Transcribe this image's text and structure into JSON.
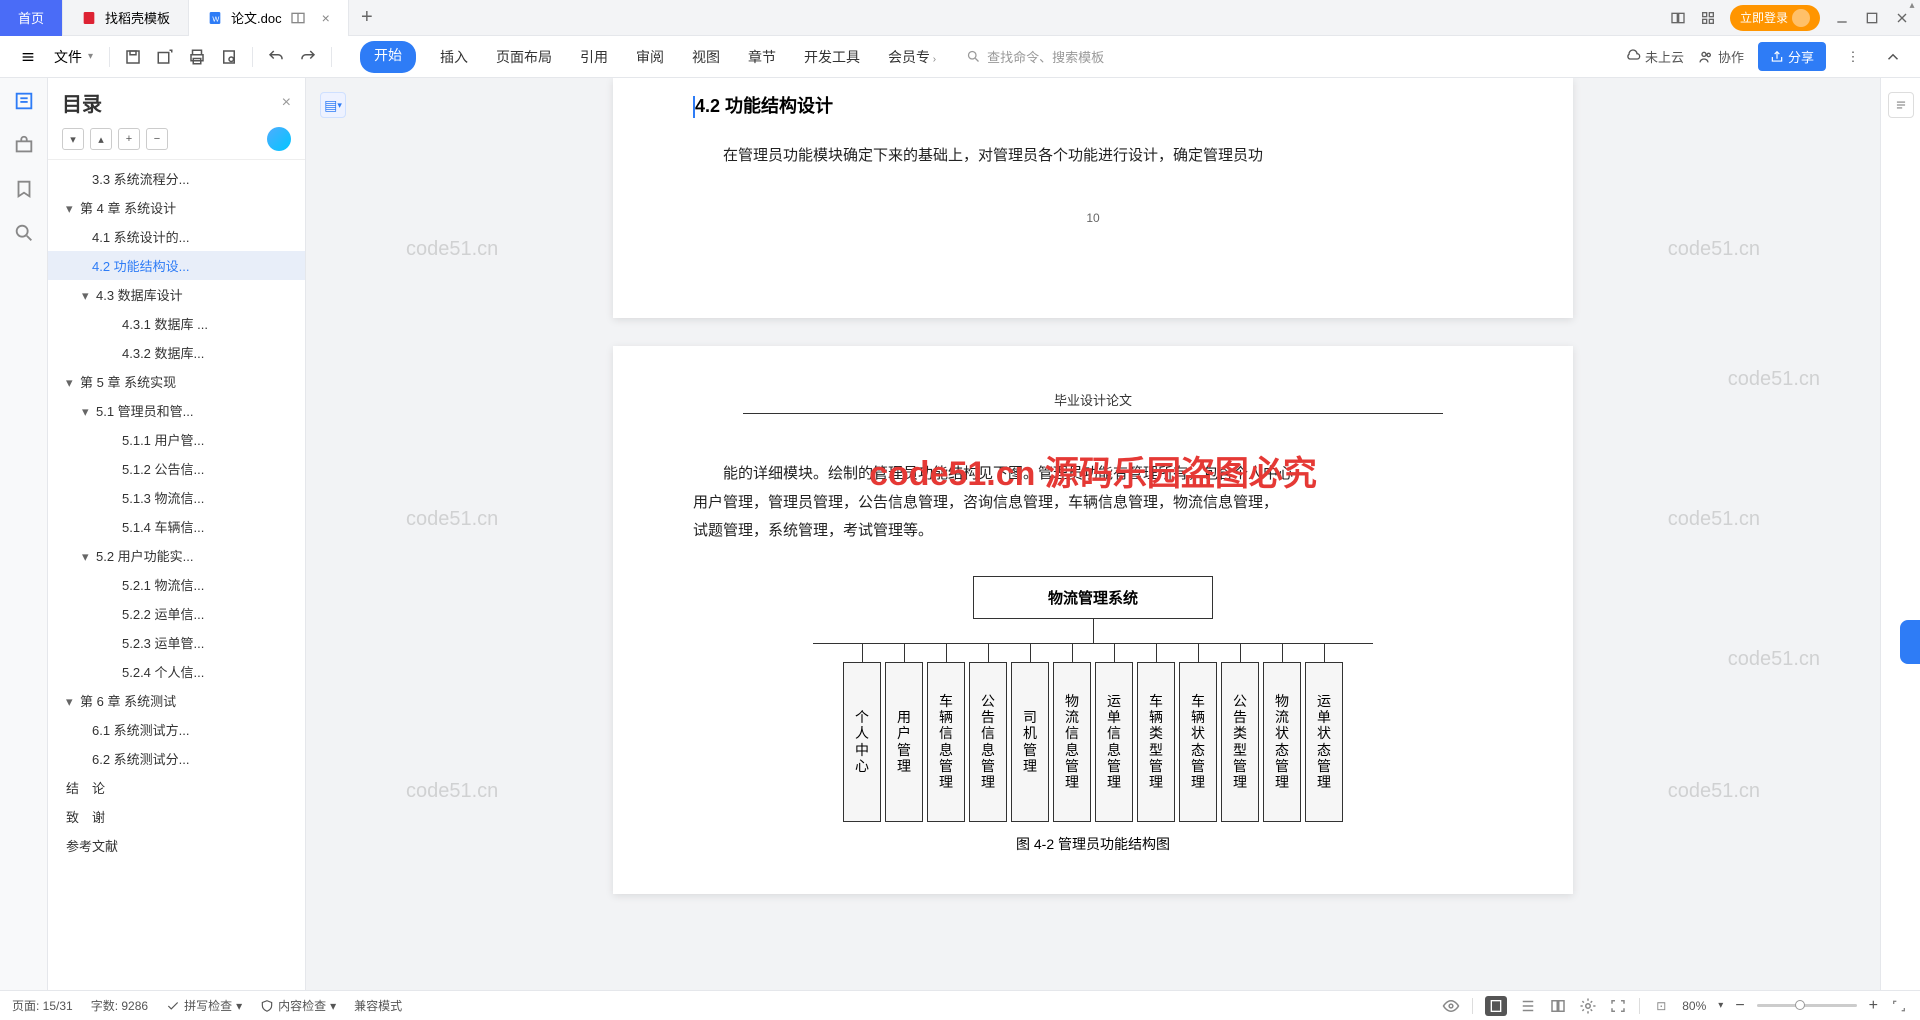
{
  "tabs": {
    "home": "首页",
    "tab1": "找稻壳模板",
    "tab2": "论文.doc"
  },
  "login": "立即登录",
  "file_menu": "文件",
  "ribbon": {
    "start": "开始",
    "insert": "插入",
    "pageLayout": "页面布局",
    "reference": "引用",
    "review": "审阅",
    "view": "视图",
    "chapter": "章节",
    "devtools": "开发工具",
    "member": "会员专"
  },
  "search_placeholder": "查找命令、搜索模板",
  "cloud": "未上云",
  "collab": "协作",
  "share": "分享",
  "outline_title": "目录",
  "tree": {
    "i0": "3.3 系统流程分...",
    "i1": "第 4 章  系统设计",
    "i2": "4.1 系统设计的...",
    "i3": "4.2 功能结构设...",
    "i4": "4.3 数据库设计",
    "i5": "4.3.1 数据库 ...",
    "i6": "4.3.2 数据库...",
    "i7": "第 5 章  系统实现",
    "i8": "5.1 管理员和管...",
    "i9": "5.1.1 用户管...",
    "i10": "5.1.2 公告信...",
    "i11": "5.1.3 物流信...",
    "i12": "5.1.4 车辆信...",
    "i13": "5.2 用户功能实...",
    "i14": "5.2.1 物流信...",
    "i15": "5.2.2 运单信...",
    "i16": "5.2.3 运单管...",
    "i17": "5.2.4 个人信...",
    "i18": "第 6 章  系统测试",
    "i19": "6.1 系统测试方...",
    "i20": "6.2 系统测试分...",
    "i21": "结　论",
    "i22": "致　谢",
    "i23": "参考文献"
  },
  "doc": {
    "heading": "4.2  功能结构设计",
    "p1": "在管理员功能模块确定下来的基础上，对管理员各个功能进行设计，确定管理员功",
    "pagenum": "10",
    "header2": "毕业设计论文",
    "p2a": "能的详细模块。绘制的管理员功能结构见下图。管理员功能有管理所有，包含个人中心，",
    "p2b": "用户管理，管理员管理，公告信息管理，咨询信息管理，车辆信息管理，物流信息管理，",
    "p2c": "试题管理，系统管理，考试管理等。",
    "org_root": "物流管理系统",
    "org": {
      "c1": "个人中心",
      "c2": "用户管理",
      "c3": "车辆信息管理",
      "c4": "公告信息管理",
      "c5": "司机管理",
      "c6": "物流信息管理",
      "c7": "运单信息管理",
      "c8": "车辆类型管理",
      "c9": "车辆状态管理",
      "c10": "公告类型管理",
      "c11": "物流状态管理",
      "c12": "运单状态管理"
    },
    "caption": "图 4-2  管理员功能结构图"
  },
  "overlay": "code51.cn 源码乐园盗图必究",
  "watermark": "code51.cn",
  "status": {
    "page": "页面: 15/31",
    "words": "字数: 9286",
    "spell": "拼写检查",
    "content": "内容检查",
    "compat": "兼容模式",
    "zoom": "80%"
  }
}
